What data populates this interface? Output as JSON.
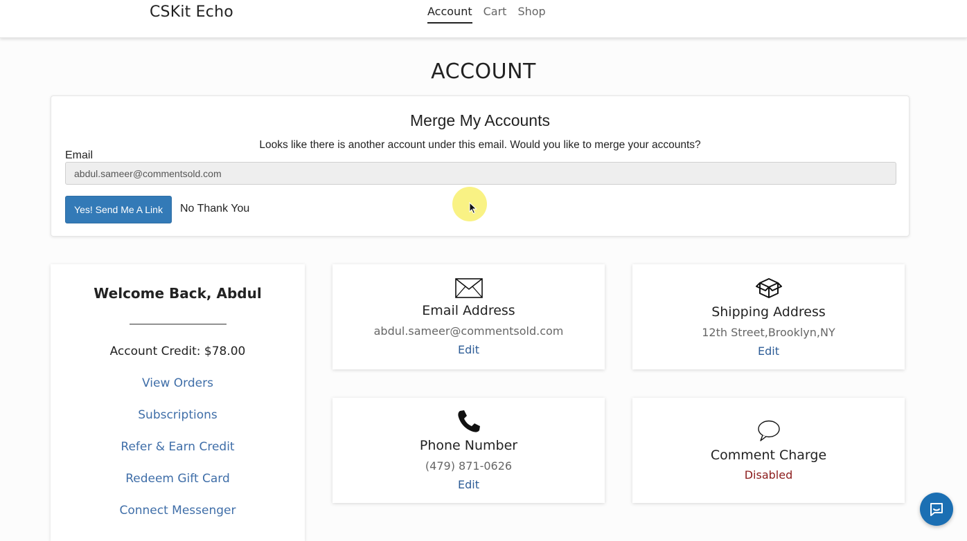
{
  "header": {
    "brand": "CSKit Echo",
    "nav": [
      {
        "label": "Account",
        "active": true
      },
      {
        "label": "Cart",
        "active": false
      },
      {
        "label": "Shop",
        "active": false
      }
    ]
  },
  "page": {
    "title": "ACCOUNT"
  },
  "merge": {
    "title": "Merge My Accounts",
    "message": "Looks like there is another account under this email. Would you like to merge your accounts?",
    "email_label": "Email",
    "email_value": "abdul.sameer@commentsold.com",
    "primary_button": "Yes! Send Me A Link",
    "secondary_button": "No Thank You"
  },
  "sidebar": {
    "welcome": "Welcome Back, Abdul",
    "credit": "Account Credit: $78.00",
    "links": [
      "View Orders",
      "Subscriptions",
      "Refer & Earn Credit",
      "Redeem Gift Card",
      "Connect Messenger"
    ]
  },
  "cards": {
    "email": {
      "icon": "envelope-icon",
      "title": "Email Address",
      "value": "abdul.sameer@commentsold.com",
      "edit": "Edit"
    },
    "shipping": {
      "icon": "box-icon",
      "title": "Shipping Address",
      "value": "12th Street,Brooklyn,NY",
      "edit": "Edit"
    },
    "phone": {
      "icon": "phone-icon",
      "title": "Phone Number",
      "value": "(479) 871-0626",
      "edit": "Edit"
    },
    "comment": {
      "icon": "speech-bubble-icon",
      "title": "Comment Charge",
      "status": "Disabled"
    }
  },
  "colors": {
    "primary": "#337ab7",
    "link": "#3f6ea8",
    "disabled": "#8b1a1a",
    "chat_button": "#1b6fb3"
  },
  "chat": {
    "icon": "chat-icon"
  }
}
